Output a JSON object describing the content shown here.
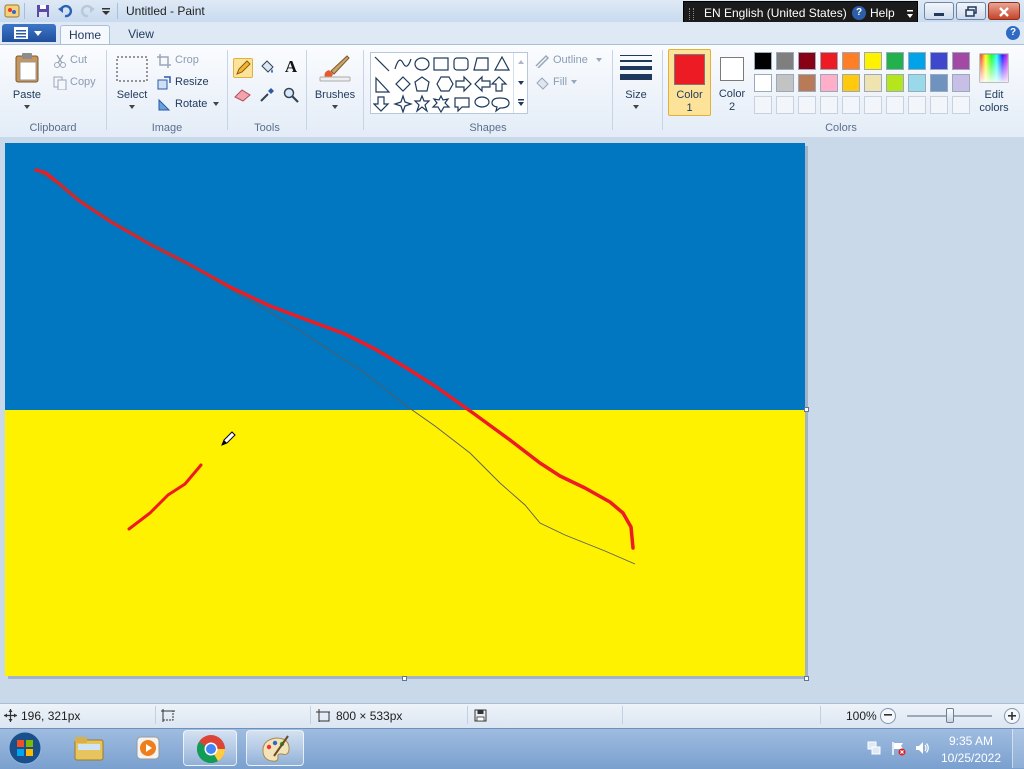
{
  "window": {
    "title": "Untitled - Paint"
  },
  "language_bar": {
    "language": "EN English (United States)",
    "help": "Help"
  },
  "ribbon": {
    "tabs": [
      {
        "label": "Home"
      },
      {
        "label": "View"
      }
    ],
    "clipboard": {
      "group": "Clipboard",
      "paste": "Paste",
      "cut": "Cut",
      "copy": "Copy"
    },
    "image": {
      "group": "Image",
      "select": "Select",
      "crop": "Crop",
      "resize": "Resize",
      "rotate": "Rotate"
    },
    "tools": {
      "group": "Tools"
    },
    "brushes": {
      "label": "Brushes"
    },
    "shapes": {
      "group": "Shapes",
      "outline": "Outline",
      "fill": "Fill"
    },
    "size": {
      "label": "Size"
    },
    "colors": {
      "group": "Colors",
      "color1": "Color 1",
      "color1_l1": "Color",
      "color1_l2": "1",
      "color2": "Color 2",
      "color2_l1": "Color",
      "color2_l2": "2",
      "edit_l1": "Edit",
      "edit_l2": "colors",
      "color1_value": "#ed1c24",
      "color2_value": "#ffffff",
      "palette_row1": [
        "#000000",
        "#7f7f7f",
        "#880015",
        "#ed1c24",
        "#ff7f27",
        "#fff200",
        "#22b14c",
        "#00a2e8",
        "#3f48cc",
        "#a349a4"
      ],
      "palette_row2": [
        "#ffffff",
        "#c3c3c3",
        "#b97a57",
        "#ffaec9",
        "#ffc90e",
        "#efe4b0",
        "#b5e61d",
        "#99d9ea",
        "#7092be",
        "#c8bfe7"
      ]
    }
  },
  "canvas": {
    "top_color": "#0077c0",
    "bottom_color": "#fff200",
    "stroke_color": "#ed1c24"
  },
  "status": {
    "cursor_pos": "196, 321px",
    "canvas_size": "800 × 533px",
    "zoom": "100%"
  },
  "taskbar": {
    "time": "9:35 AM",
    "date": "10/25/2022"
  }
}
